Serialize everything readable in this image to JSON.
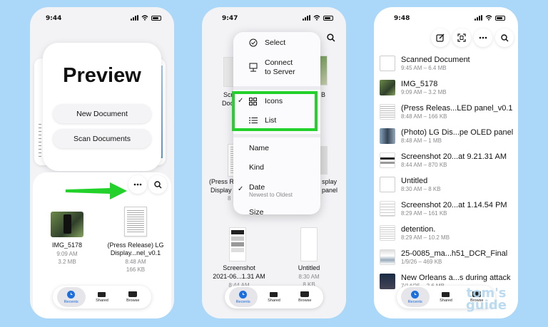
{
  "phone1": {
    "time": "9:44",
    "title": "Preview",
    "new_document": "New Document",
    "scan_documents": "Scan Documents",
    "files": [
      {
        "name": "IMG_5178",
        "date": "9:09 AM",
        "size": "3.2 MB"
      },
      {
        "name1": "(Press Release) LG",
        "name2": "Display...nel_v0.1",
        "date": "8:48 AM",
        "size": "166 KB"
      }
    ],
    "tabs": [
      "Recents",
      "Shared",
      "Browse"
    ]
  },
  "phone2": {
    "time": "9:47",
    "menu": {
      "select": "Select",
      "connect1": "Connect",
      "connect2": "to Server",
      "icons": "Icons",
      "list": "List",
      "name": "Name",
      "kind": "Kind",
      "date": "Date",
      "date_sub": "Newest to Oldest",
      "size": "Size"
    },
    "bg": {
      "scre": "Scre",
      "doc": "Doc",
      "b": "B",
      "press1": "(Press R",
      "press2": "Display",
      "d1": "8",
      "splay": "splay",
      "panel": "panel",
      "shot1": "Screenshot",
      "shot2": "2021-06...1.31 AM",
      "shot_date": "8:44 AM",
      "untitled": "Untitled",
      "untitled_date": "8:30 AM",
      "untitled_size": "8 KB"
    },
    "tabs": [
      "Recents",
      "Shared",
      "Browse"
    ]
  },
  "phone3": {
    "time": "9:48",
    "rows": [
      {
        "name": "Scanned Document",
        "meta": "9:45 AM – 6.4 MB"
      },
      {
        "name": "IMG_5178",
        "meta": "9:09 AM – 3.2 MB"
      },
      {
        "name": "(Press Releas...LED panel_v0.1",
        "meta": "8:48 AM – 166 KB"
      },
      {
        "name": "(Photo) LG Dis...pe OLED panel",
        "meta": "8:48 AM – 1 MB"
      },
      {
        "name": "Screenshot 20...at 9.21.31 AM",
        "meta": "8:44 AM – 870 KB"
      },
      {
        "name": "Untitled",
        "meta": "8:30 AM – 8 KB"
      },
      {
        "name": "Screenshot 20...at 1.14.54 PM",
        "meta": "8:29 AM – 161 KB"
      },
      {
        "name": "detention.",
        "meta": "8:29 AM – 10.2 MB"
      },
      {
        "name": "25-0085_ma...h51_DCR_Final",
        "meta": "1/9/26 – 469 KB"
      },
      {
        "name": "New Orleans a...s during attack",
        "meta": "7/14/25 – 2.6 MB"
      }
    ],
    "tabs": [
      "Recents",
      "Shared",
      "Browse"
    ]
  },
  "watermark": {
    "line1": "tom's",
    "line2": "guide"
  },
  "colors": {
    "background": "#abd8f8",
    "accent": "#1b6fe0",
    "highlight": "#22d12a",
    "arrow": "#22d12a"
  }
}
